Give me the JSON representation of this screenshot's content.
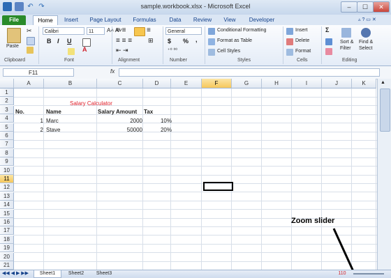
{
  "window": {
    "title": "sample.workbook.xlsx - Microsoft Excel",
    "buttons": [
      "–",
      "☐",
      "✕"
    ]
  },
  "tabs": [
    "File",
    "Home",
    "Insert",
    "Page Layout",
    "Formulas",
    "Data",
    "Review",
    "View",
    "Developer"
  ],
  "active_tab": "Home",
  "ribbon": {
    "clipboard": {
      "paste": "Paste",
      "label": "Clipboard"
    },
    "font": {
      "name": "Calibri",
      "size": "11",
      "label": "Font",
      "bold": "B",
      "italic": "I",
      "underline": "U",
      "font_color_glyph": "A"
    },
    "alignment": {
      "label": "Alignment"
    },
    "number": {
      "format": "General",
      "currency": "$",
      "percent": "%",
      "comma": ",",
      "label": "Number"
    },
    "styles": {
      "conditional": "Conditional Formatting",
      "as_table": "Format as Table",
      "cell_styles": "Cell Styles",
      "label": "Styles"
    },
    "cells": {
      "insert": "Insert",
      "delete": "Delete",
      "format": "Format",
      "label": "Cells"
    },
    "editing": {
      "sigma": "Σ",
      "sort": "Sort &",
      "filter": "Filter",
      "find": "Find &",
      "select": "Select",
      "label": "Editing"
    }
  },
  "formula_bar": {
    "name_box": "F11",
    "fx": "fx",
    "value": ""
  },
  "columns": [
    "A",
    "B",
    "C",
    "D",
    "E",
    "F",
    "G",
    "H",
    "I",
    "J",
    "K"
  ],
  "selected_column": "F",
  "rows": [
    "1",
    "2",
    "3",
    "4",
    "5",
    "6",
    "7",
    "8",
    "9",
    "10",
    "11",
    "12",
    "13",
    "14",
    "15",
    "16",
    "17",
    "18",
    "19",
    "20",
    "21"
  ],
  "selected_row": "11",
  "sheet": {
    "title": "Salary Calculator",
    "headers": [
      "No.",
      "Name",
      "Salary Amount",
      "Tax"
    ],
    "data": [
      [
        "1",
        "Marc",
        "2000",
        "10%"
      ],
      [
        "2",
        "Stave",
        "50000",
        "20%"
      ]
    ]
  },
  "sheet_tabs": [
    "Sheet1",
    "Sheet2",
    "Sheet3"
  ],
  "status": {
    "zoom": "110"
  },
  "annotation": "Zoom slider",
  "colors": {
    "accent": "#2a8b2a",
    "title_red": "#e0202a",
    "selection": "#f6c75b"
  }
}
